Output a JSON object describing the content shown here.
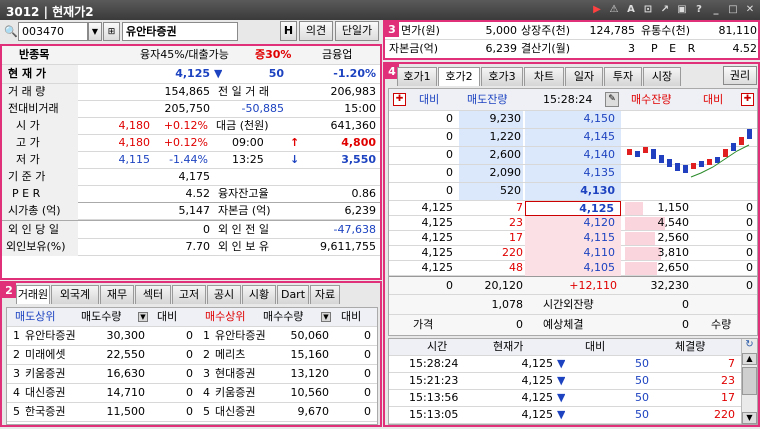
{
  "window": {
    "title": "3012 | 현재가2",
    "icons": [
      "play-icon",
      "alert-icon",
      "lock-icon",
      "pin-icon",
      "new-window-icon",
      "copy-icon",
      "help-icon",
      "minimize-icon",
      "maximize-icon",
      "close-icon"
    ]
  },
  "toolbar": {
    "code": "003470",
    "name": "유안타증권",
    "h_btn": "H",
    "opinion_btn": "의견",
    "unit_btn": "단일가"
  },
  "quote": {
    "head": {
      "label": "반종목",
      "margin": "융자45%/대출가능",
      "deposit": "증30%",
      "flag": "금융업"
    },
    "current": {
      "label": "현 재 가",
      "price": "4,125",
      "change": "50",
      "rate": "-1.20%"
    },
    "volume": {
      "label": "거 래 량",
      "value": "154,865",
      "prev_label": "전 일 거 래",
      "prev": "206,983"
    },
    "prevvol": {
      "label": "전대비거래",
      "value": "205,750",
      "diff": "-50,885",
      "time": "15:00"
    },
    "open": {
      "label": "시 가",
      "price": "4,180",
      "rate": "+0.12%",
      "amt_label": "대금 (천원)",
      "amt": "641,360"
    },
    "high": {
      "label": "고 가",
      "price": "4,180",
      "rate": "+0.12%",
      "time": "09:00",
      "limit": "4,800"
    },
    "low": {
      "label": "저 가",
      "price": "4,115",
      "rate": "-1.44%",
      "time": "13:25",
      "limit": "3,550"
    },
    "base": {
      "label": "기 준 가",
      "price": "4,175"
    },
    "per": {
      "label": "P E R",
      "value": "4.52",
      "loan_label": "융자잔고율",
      "loan": "0.86"
    },
    "mcap": {
      "label": "시가총 (억)",
      "value": "5,147",
      "cap_label": "자본금 (억)",
      "cap": "6,239"
    },
    "foreign_today": {
      "label": "외 인 당 일",
      "value": "0",
      "prev_label": "외 인 전 일",
      "prev": "-47,638"
    },
    "foreign_hold": {
      "label": "외인보유(%)",
      "value": "7.70",
      "hold_label": "외 인 보 유",
      "hold": "9,611,755"
    }
  },
  "broker": {
    "tabs": [
      "거래원",
      "외국계",
      "재무",
      "섹터",
      "고저",
      "공시",
      "시황",
      "Dart",
      "자료"
    ],
    "headers": {
      "sell": "매도상위",
      "sell_qty": "매도수량",
      "sell_diff": "대비",
      "buy": "매수상위",
      "buy_qty": "매수수량",
      "buy_diff": "대비"
    },
    "rows": [
      {
        "n": "1",
        "sname": "유안타증권",
        "sqty": "30,300",
        "sdiff": "0",
        "bn": "1",
        "bname": "유안타증권",
        "bqty": "50,060",
        "bdiff": "0"
      },
      {
        "n": "2",
        "sname": "미래에셋",
        "sqty": "22,550",
        "sdiff": "0",
        "bn": "2",
        "bname": "메리츠",
        "bqty": "15,160",
        "bdiff": "0"
      },
      {
        "n": "3",
        "sname": "키움증권",
        "sqty": "16,630",
        "sdiff": "0",
        "bn": "3",
        "bname": "현대증권",
        "bqty": "13,120",
        "bdiff": "0"
      },
      {
        "n": "4",
        "sname": "대신증권",
        "sqty": "14,710",
        "sdiff": "0",
        "bn": "4",
        "bname": "키움증권",
        "bqty": "10,560",
        "bdiff": "0"
      },
      {
        "n": "5",
        "sname": "한국증권",
        "sqty": "11,500",
        "sdiff": "0",
        "bn": "5",
        "bname": "대신증권",
        "bqty": "9,670",
        "bdiff": "0"
      }
    ]
  },
  "info": {
    "par_label": "면가(원)",
    "par": "5,000",
    "listed_label": "상장주(천)",
    "listed": "124,785",
    "float_label": "유통수(천)",
    "float": "81,110",
    "capital_label": "자본금(억)",
    "capital": "6,239",
    "settle_label": "결산기(월)",
    "settle": "3",
    "per_label": "P E R",
    "per": "4.52"
  },
  "orderbook": {
    "tabs": [
      "호가1",
      "호가2",
      "호가3",
      "차트",
      "일자",
      "투자",
      "시장"
    ],
    "right_btn": "권리",
    "header": {
      "diff_l": "대비",
      "ask_qty": "매도잔량",
      "time": "15:28:24",
      "bid_qty": "매수잔량",
      "diff_r": "대비"
    },
    "asks": [
      {
        "d": "0",
        "q": "9,230",
        "p": "4,150"
      },
      {
        "d": "0",
        "q": "1,220",
        "p": "4,145"
      },
      {
        "d": "0",
        "q": "2,600",
        "p": "4,140"
      },
      {
        "d": "0",
        "q": "2,090",
        "p": "4,135"
      },
      {
        "d": "0",
        "q": "520",
        "p": "4,130"
      }
    ],
    "bids": [
      {
        "l": "4,125",
        "lq": "7",
        "p": "4,125",
        "q": "1,150",
        "d": "0"
      },
      {
        "l": "4,125",
        "lq": "23",
        "p": "4,120",
        "q": "4,540",
        "d": "0"
      },
      {
        "l": "4,125",
        "lq": "17",
        "p": "4,115",
        "q": "2,560",
        "d": "0"
      },
      {
        "l": "4,125",
        "lq": "220",
        "p": "4,110",
        "q": "3,810",
        "d": "0"
      },
      {
        "l": "4,125",
        "lq": "48",
        "p": "4,105",
        "q": "2,650",
        "d": "0"
      }
    ],
    "totals": {
      "ld": "0",
      "ask": "20,120",
      "diff": "+12,110",
      "bid": "32,230",
      "rd": "0"
    },
    "after": {
      "v": "1,078",
      "label": "시간외잔량",
      "v2": "0"
    },
    "expect": {
      "price_label": "가격",
      "price": "0",
      "exp_label": "예상체결",
      "exp": "0",
      "qty_label": "수량"
    }
  },
  "ticks": {
    "headers": [
      "시간",
      "현재가",
      "대비",
      "체결량"
    ],
    "rows": [
      {
        "t": "15:28:24",
        "p": "4,125",
        "d": "50",
        "v": "7"
      },
      {
        "t": "15:21:23",
        "p": "4,125",
        "d": "50",
        "v": "23"
      },
      {
        "t": "15:13:56",
        "p": "4,125",
        "d": "50",
        "v": "17"
      },
      {
        "t": "15:13:05",
        "p": "4,125",
        "d": "50",
        "v": "220"
      }
    ]
  }
}
